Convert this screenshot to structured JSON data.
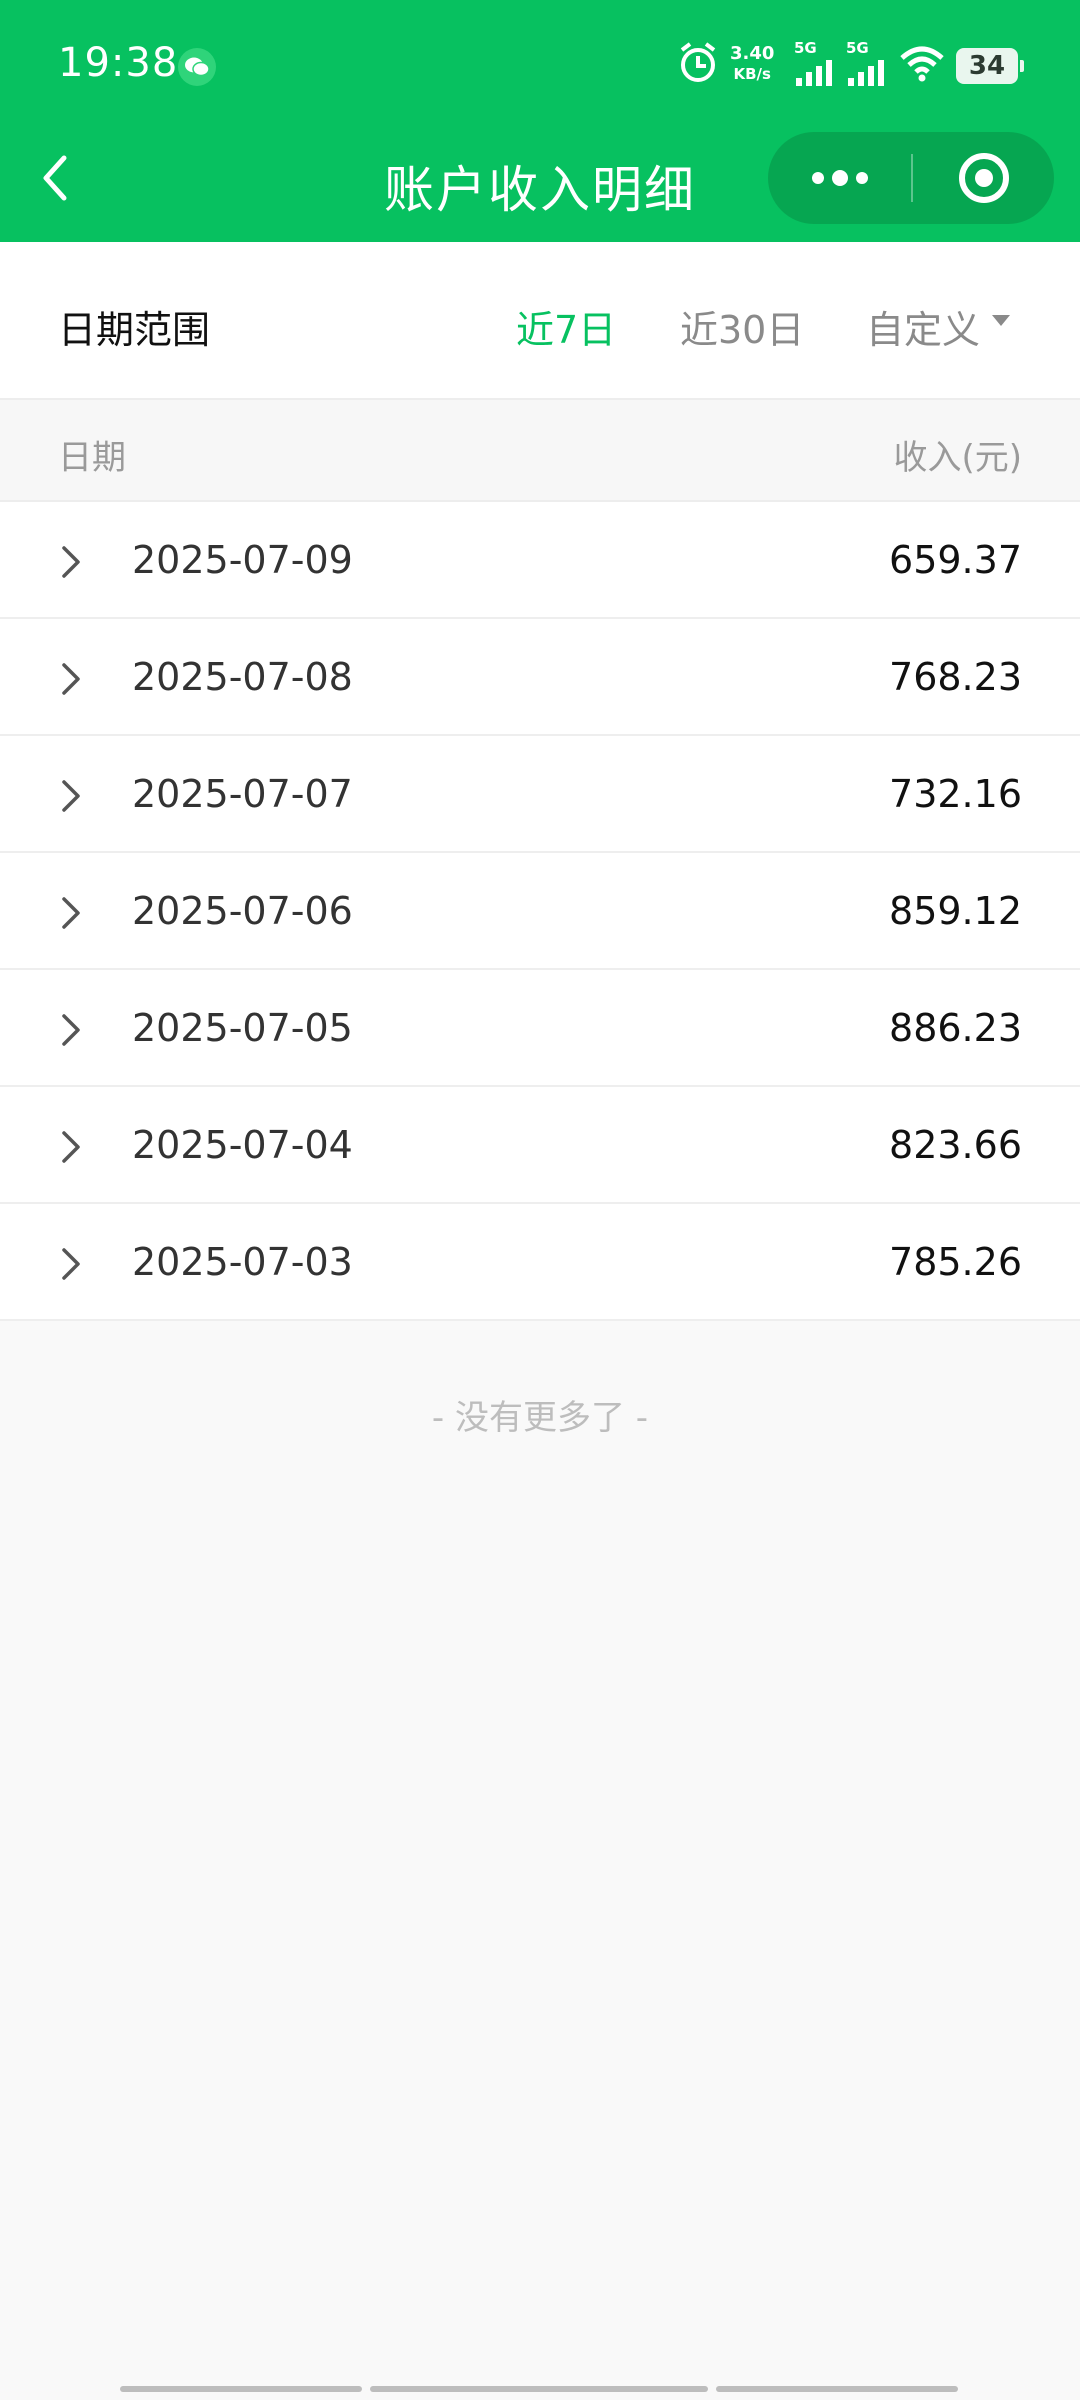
{
  "status_bar": {
    "time": "19:38",
    "net_speed_value": "3.40",
    "net_speed_unit": "KB/s",
    "signal_1_label": "5G",
    "signal_2_label": "5G",
    "battery": "34"
  },
  "nav": {
    "title": "账户收入明细",
    "icons": [
      "back-arrow-icon",
      "more-dots-icon",
      "close-target-icon"
    ]
  },
  "filter": {
    "label": "日期范围",
    "options": [
      {
        "label": "近7日",
        "active": true
      },
      {
        "label": "近30日",
        "active": false
      },
      {
        "label": "自定义",
        "active": false
      }
    ]
  },
  "table": {
    "header_date": "日期",
    "header_income": "收入(元)",
    "rows": [
      {
        "date": "2025-07-09",
        "amount": "659.37"
      },
      {
        "date": "2025-07-08",
        "amount": "768.23"
      },
      {
        "date": "2025-07-07",
        "amount": "732.16"
      },
      {
        "date": "2025-07-06",
        "amount": "859.12"
      },
      {
        "date": "2025-07-05",
        "amount": "886.23"
      },
      {
        "date": "2025-07-04",
        "amount": "823.66"
      },
      {
        "date": "2025-07-03",
        "amount": "785.26"
      }
    ]
  },
  "footer": {
    "no_more": "- 没有更多了 -"
  },
  "colors": {
    "brand_green": "#07c160",
    "capsule_green": "#06a651"
  }
}
